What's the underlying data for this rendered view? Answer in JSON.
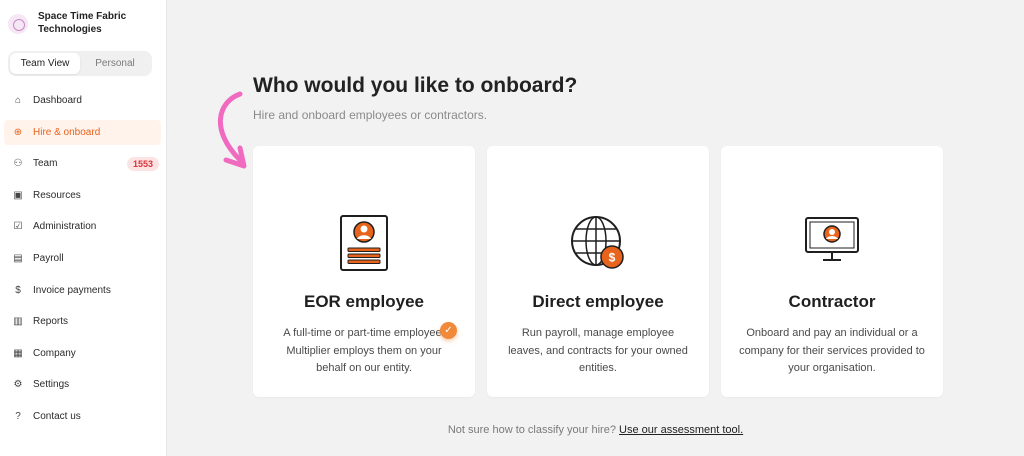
{
  "brand": {
    "name": "Space Time Fabric Technologies"
  },
  "view_toggle": {
    "team": "Team View",
    "personal": "Personal"
  },
  "nav": [
    {
      "label": "Dashboard",
      "icon": "home-icon",
      "glyph": "⌂"
    },
    {
      "label": "Hire & onboard",
      "icon": "globe-icon",
      "glyph": "⊕"
    },
    {
      "label": "Team",
      "icon": "users-icon",
      "glyph": "⚇",
      "badge": "1553"
    },
    {
      "label": "Resources",
      "icon": "folder-icon",
      "glyph": "▣"
    },
    {
      "label": "Administration",
      "icon": "checklist-icon",
      "glyph": "☑"
    },
    {
      "label": "Payroll",
      "icon": "calendar-icon",
      "glyph": "▤"
    },
    {
      "label": "Invoice payments",
      "icon": "dollar-circle-icon",
      "glyph": "$"
    },
    {
      "label": "Reports",
      "icon": "bar-chart-icon",
      "glyph": "▥"
    },
    {
      "label": "Company",
      "icon": "briefcase-icon",
      "glyph": "▦"
    },
    {
      "label": "Settings",
      "icon": "gear-icon",
      "glyph": "⚙"
    },
    {
      "label": "Contact us",
      "icon": "help-circle-icon",
      "glyph": "?"
    }
  ],
  "main": {
    "title": "Who would you like to onboard?",
    "subtitle": "Hire and onboard employees or contractors."
  },
  "cards": [
    {
      "title": "EOR employee",
      "description": "A full-time or part-time employee. Multiplier employs them on your behalf on our entity.",
      "icon": "id-document-icon",
      "selected": true
    },
    {
      "title": "Direct employee",
      "description": "Run payroll, manage employee leaves, and contracts for your owned entities.",
      "icon": "globe-dollar-icon"
    },
    {
      "title": "Contractor",
      "description": "Onboard and pay an individual or a company for their services provided to your organisation.",
      "icon": "monitor-person-icon"
    }
  ],
  "footer": {
    "text": "Not sure how to classify your hire?",
    "link": "Use our assessment tool."
  },
  "colors": {
    "accent": "#e8631c",
    "badge": "#d8343a",
    "arrow": "#f06bc0"
  }
}
